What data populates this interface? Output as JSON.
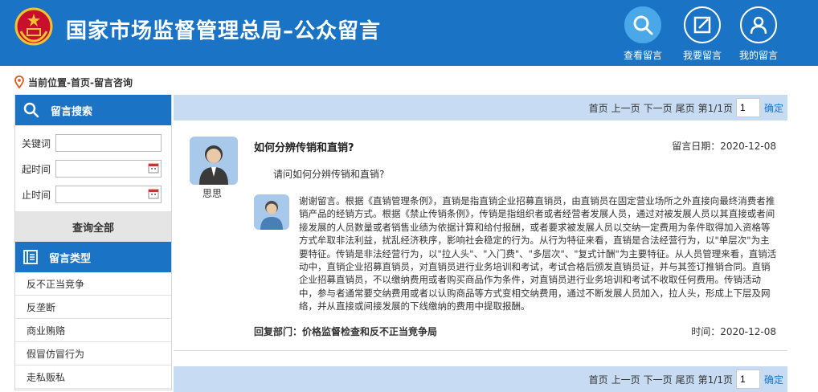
{
  "header": {
    "title": "国家市场监督管理总局–公众留言",
    "colors": {
      "bar": "#1a73c4",
      "active_nav": "#4aa8e8"
    },
    "nav": [
      {
        "label": "查看留言",
        "icon": "search-icon"
      },
      {
        "label": "我要留言",
        "icon": "edit-icon"
      },
      {
        "label": "我的留言",
        "icon": "user-icon"
      }
    ]
  },
  "breadcrumb": "当前位置-首页-留言咨询",
  "sidebar": {
    "search_title": "留言搜索",
    "keyword_label": "关键词",
    "keyword_value": "",
    "start_label": "起时间",
    "start_value": "",
    "end_label": "止时间",
    "end_value": "",
    "query_all": "查询全部",
    "type_title": "留言类型",
    "types": [
      "反不正当竞争",
      "反垄断",
      "商业贿赂",
      "假冒仿冒行为",
      "走私贩私"
    ]
  },
  "pager": {
    "first": "首页",
    "prev": "上一页",
    "next": "下一页",
    "last": "尾页",
    "page_info": "第1/1页",
    "page_value": "1",
    "confirm": "确定"
  },
  "message": {
    "title": "如何分辨传销和直销?",
    "date_label": "留言日期：",
    "date": "2020-12-08",
    "body": "请问如何分辨传销和直销?",
    "username": "思思",
    "reply": "谢谢留言。根据《直销管理条例》，直销是指直销企业招募直销员，由直销员在固定营业场所之外直接向最终消费者推销产品的经销方式。根据《禁止传销条例》，传销是指组织者或者经营者发展人员，通过对被发展人员以其直接或者间接发展的人员数量或者销售业绩为依据计算和给付报酬，或者要求被发展人员以交纳一定费用为条件取得加入资格等方式牟取非法利益，扰乱经济秩序，影响社会稳定的行为。从行为特征来看，直销是合法经营行为，以\"单层次\"为主要特征。传销是非法经营行为，以\"拉人头\"、\"入门费\"、\"多层次\"、\"复式计酬\"为主要特征。从人员管理来看，直销活动中，直销企业招募直销员，对直销员进行业务培训和考试，考试合格后颁发直销员证，并与其签订推销合同。直销企业招募直销员，不以缴纳费用或者购买商品作为条件，对直销员进行业务培训和考试不收取任何费用。传销活动中，参与者通常要交纳费用或者以认购商品等方式变相交纳费用，通过不断发展人员加入，拉人头，形成上下层及网络，并从直接或间接发展的下线缴纳的费用中提取报酬。",
    "reply_dept_label": "回复部门：",
    "reply_dept": "价格监督检查和反不正当竞争局",
    "reply_time_label": "时间：",
    "reply_time": "2020-12-08"
  }
}
